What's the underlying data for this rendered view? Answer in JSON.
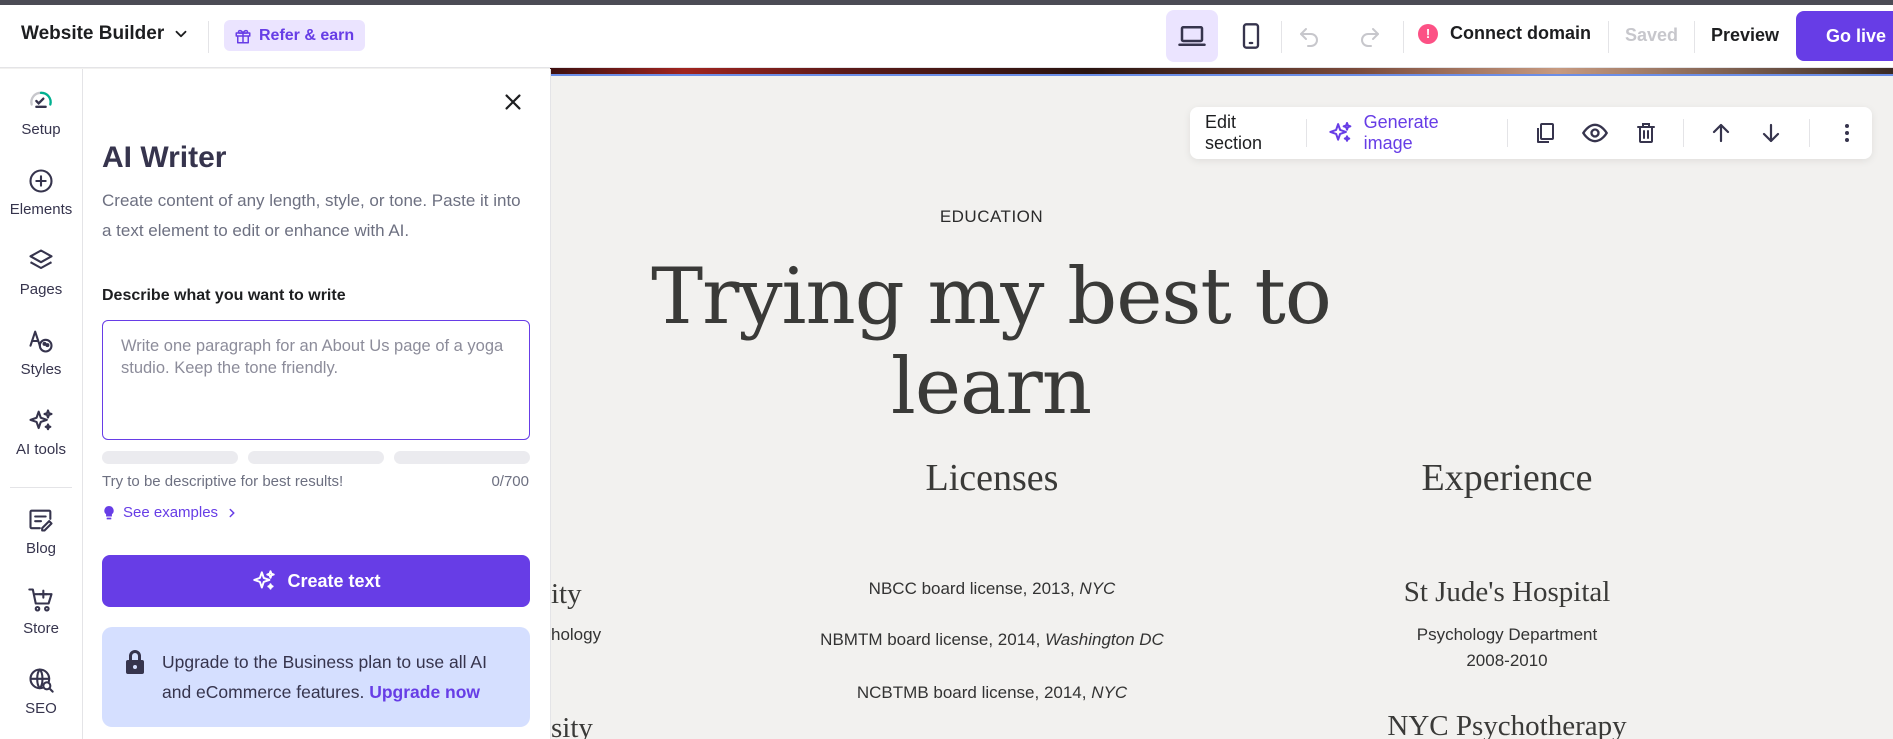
{
  "topbar": {
    "brand": "Website Builder",
    "refer": "Refer & earn",
    "connect": "Connect domain",
    "alert": "!",
    "saved": "Saved",
    "preview": "Preview",
    "golive": "Go live"
  },
  "rail": {
    "items": [
      "Setup",
      "Elements",
      "Pages",
      "Styles",
      "AI tools",
      "Blog",
      "Store",
      "SEO"
    ]
  },
  "panel": {
    "title": "AI Writer",
    "description": "Create content of any length, style, or tone. Paste it into a text element to edit or enhance with AI.",
    "label": "Describe what you want to write",
    "placeholder": "Write one paragraph for an About Us page of a yoga studio. Keep the tone friendly.",
    "hint": "Try to be descriptive for best results!",
    "counter": "0/700",
    "examples": "See examples",
    "create": "Create text",
    "upgrade_text": "Upgrade to the Business plan to use all AI and eCommerce features.",
    "upgrade_link": "Upgrade now"
  },
  "section_toolbar": {
    "edit": "Edit section",
    "generate": "Generate image"
  },
  "canvas": {
    "eyebrow": "EDUCATION",
    "headline": "Trying my best to learn",
    "col1_partial": {
      "heading1": "ity",
      "line1": "hology",
      "heading2": "sity"
    },
    "licenses": {
      "heading": "Licenses",
      "items": [
        {
          "text": "NBCC board license, 2013,",
          "place": "NYC"
        },
        {
          "text": "NBMTM board license, 2014,",
          "place": "Washington DC"
        },
        {
          "text": "NCBTMB board license, 2014,",
          "place": "NYC"
        }
      ]
    },
    "experience": {
      "heading": "Experience",
      "place1": "St Jude's Hospital",
      "dept1": "Psychology Department",
      "years1": "2008-2010",
      "place2": "NYC Psychotherapy"
    }
  },
  "colors": {
    "accent": "#673de6",
    "canvas_bg": "#f2f1ef",
    "upgrade_bg": "#d5dfff",
    "alert": "#fc5185"
  }
}
